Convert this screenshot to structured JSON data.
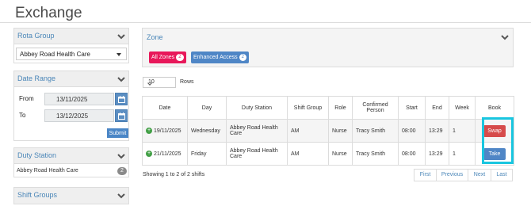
{
  "page": {
    "title": "Exchange"
  },
  "filters": {
    "rota_group": {
      "label": "Rota Group",
      "value": "Abbey Road Health Care"
    },
    "date_range": {
      "label": "Date Range",
      "from_label": "From",
      "from_value": "13/11/2025",
      "to_label": "To",
      "to_value": "13/12/2025",
      "submit_label": "Submit"
    },
    "duty_station": {
      "label": "Duty Station",
      "name": "Abbey Road Health Care",
      "count": "2"
    },
    "shift_groups": {
      "label": "Shift Groups"
    }
  },
  "zone": {
    "label": "Zone",
    "chips": [
      {
        "label": "All Zones",
        "count": "2",
        "color": "#e8185a"
      },
      {
        "label": "Enhanced Access",
        "count": "2",
        "color": "#4f86c6"
      }
    ]
  },
  "table": {
    "rows_select": "10",
    "rows_label": "Rows",
    "headers": [
      "Date",
      "Day",
      "Duty Station",
      "Shift Group",
      "Role",
      "Confirmed Person",
      "Start",
      "End",
      "Week",
      "Book"
    ],
    "rows": [
      {
        "date": "19/11/2025",
        "day": "Wednesday",
        "station": "Abbey Road Health Care",
        "group": "AM",
        "role": "Nurse",
        "person": "Tracy Smith",
        "start": "08:00",
        "end": "13:29",
        "week": "1",
        "action": "Swap"
      },
      {
        "date": "21/11/2025",
        "day": "Friday",
        "station": "Abbey Road Health Care",
        "group": "AM",
        "role": "Nurse",
        "person": "Tracy Smith",
        "start": "08:00",
        "end": "13:29",
        "week": "1",
        "action": "Take"
      }
    ],
    "showing": "Showing 1 to 2 of 2 shifts",
    "pager": [
      "First",
      "Previous",
      "Next",
      "Last"
    ]
  },
  "colors": {
    "accent": "#4a86b8",
    "swap": "#d64b4b",
    "take": "#4f86c6",
    "highlight": "#19c6e0",
    "add": "#43a047"
  },
  "icons": [
    "chevron-down-icon",
    "calendar-icon",
    "plus-icon",
    "caret-down-icon"
  ]
}
